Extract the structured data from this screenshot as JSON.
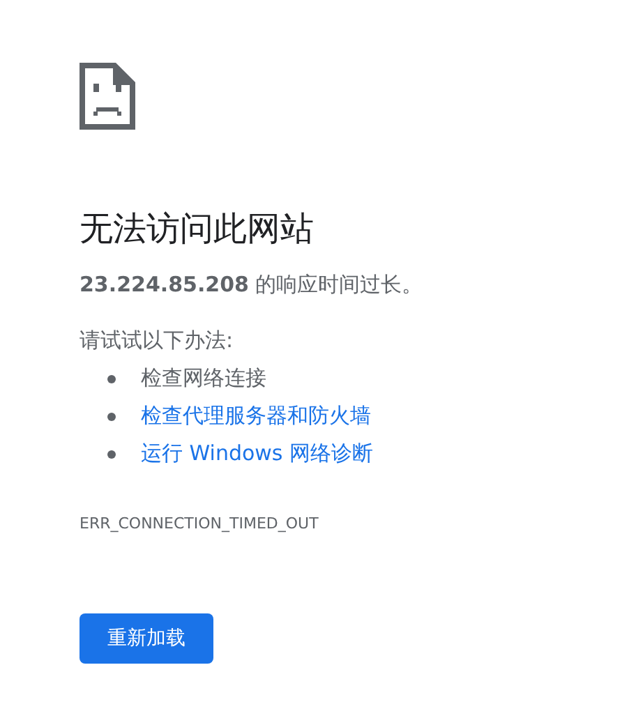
{
  "heading": "无法访问此网站",
  "summary": "**23.224.85.208** 的响应时间过长。",
  "suggestions_intro": "请试试以下办法:",
  "suggestions": [
    {
      "kind": "text",
      "label": "检查网络连接"
    },
    {
      "kind": "link",
      "label": "检查代理服务器和防火墙"
    },
    {
      "kind": "link",
      "label": "运行 Windows 网络诊断"
    }
  ],
  "error_code": "ERR_CONNECTION_TIMED_OUT",
  "button": "重新加载"
}
